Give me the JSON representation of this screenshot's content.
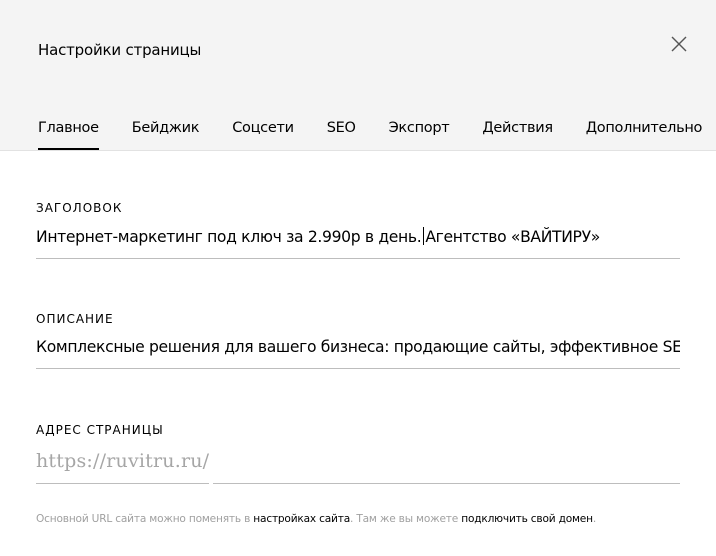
{
  "dialog": {
    "title": "Настройки страницы",
    "close_icon": "close-icon"
  },
  "tabs": [
    {
      "label": "Главное",
      "active": true
    },
    {
      "label": "Бейджик",
      "active": false
    },
    {
      "label": "Соцсети",
      "active": false
    },
    {
      "label": "SEO",
      "active": false
    },
    {
      "label": "Экспорт",
      "active": false
    },
    {
      "label": "Действия",
      "active": false
    },
    {
      "label": "Дополнительно",
      "active": false
    }
  ],
  "fields": {
    "heading": {
      "label": "Заголовок",
      "value_before_caret": "Интернет-маркетинг под ключ за 2.990р в день.",
      "value_after_caret": "Агентство «ВАЙТИРУ»"
    },
    "description": {
      "label": "Описание",
      "value": "Комплексные решения для вашего бизнеса: продающие сайты, эффективное SEO"
    },
    "address": {
      "label": "Адрес страницы",
      "prefix": "https://ruvitru.ru/",
      "value": ""
    }
  },
  "hint": {
    "text1": "Основной URL сайта можно поменять в ",
    "link1": "настройках сайта",
    "text2": ". Там же вы можете ",
    "link2": "подключить свой домен",
    "text3": "."
  },
  "colors": {
    "header_bg": "#f4f4f4",
    "text": "#000000",
    "muted": "#a0a0a0",
    "underline": "#bdbdbd"
  }
}
